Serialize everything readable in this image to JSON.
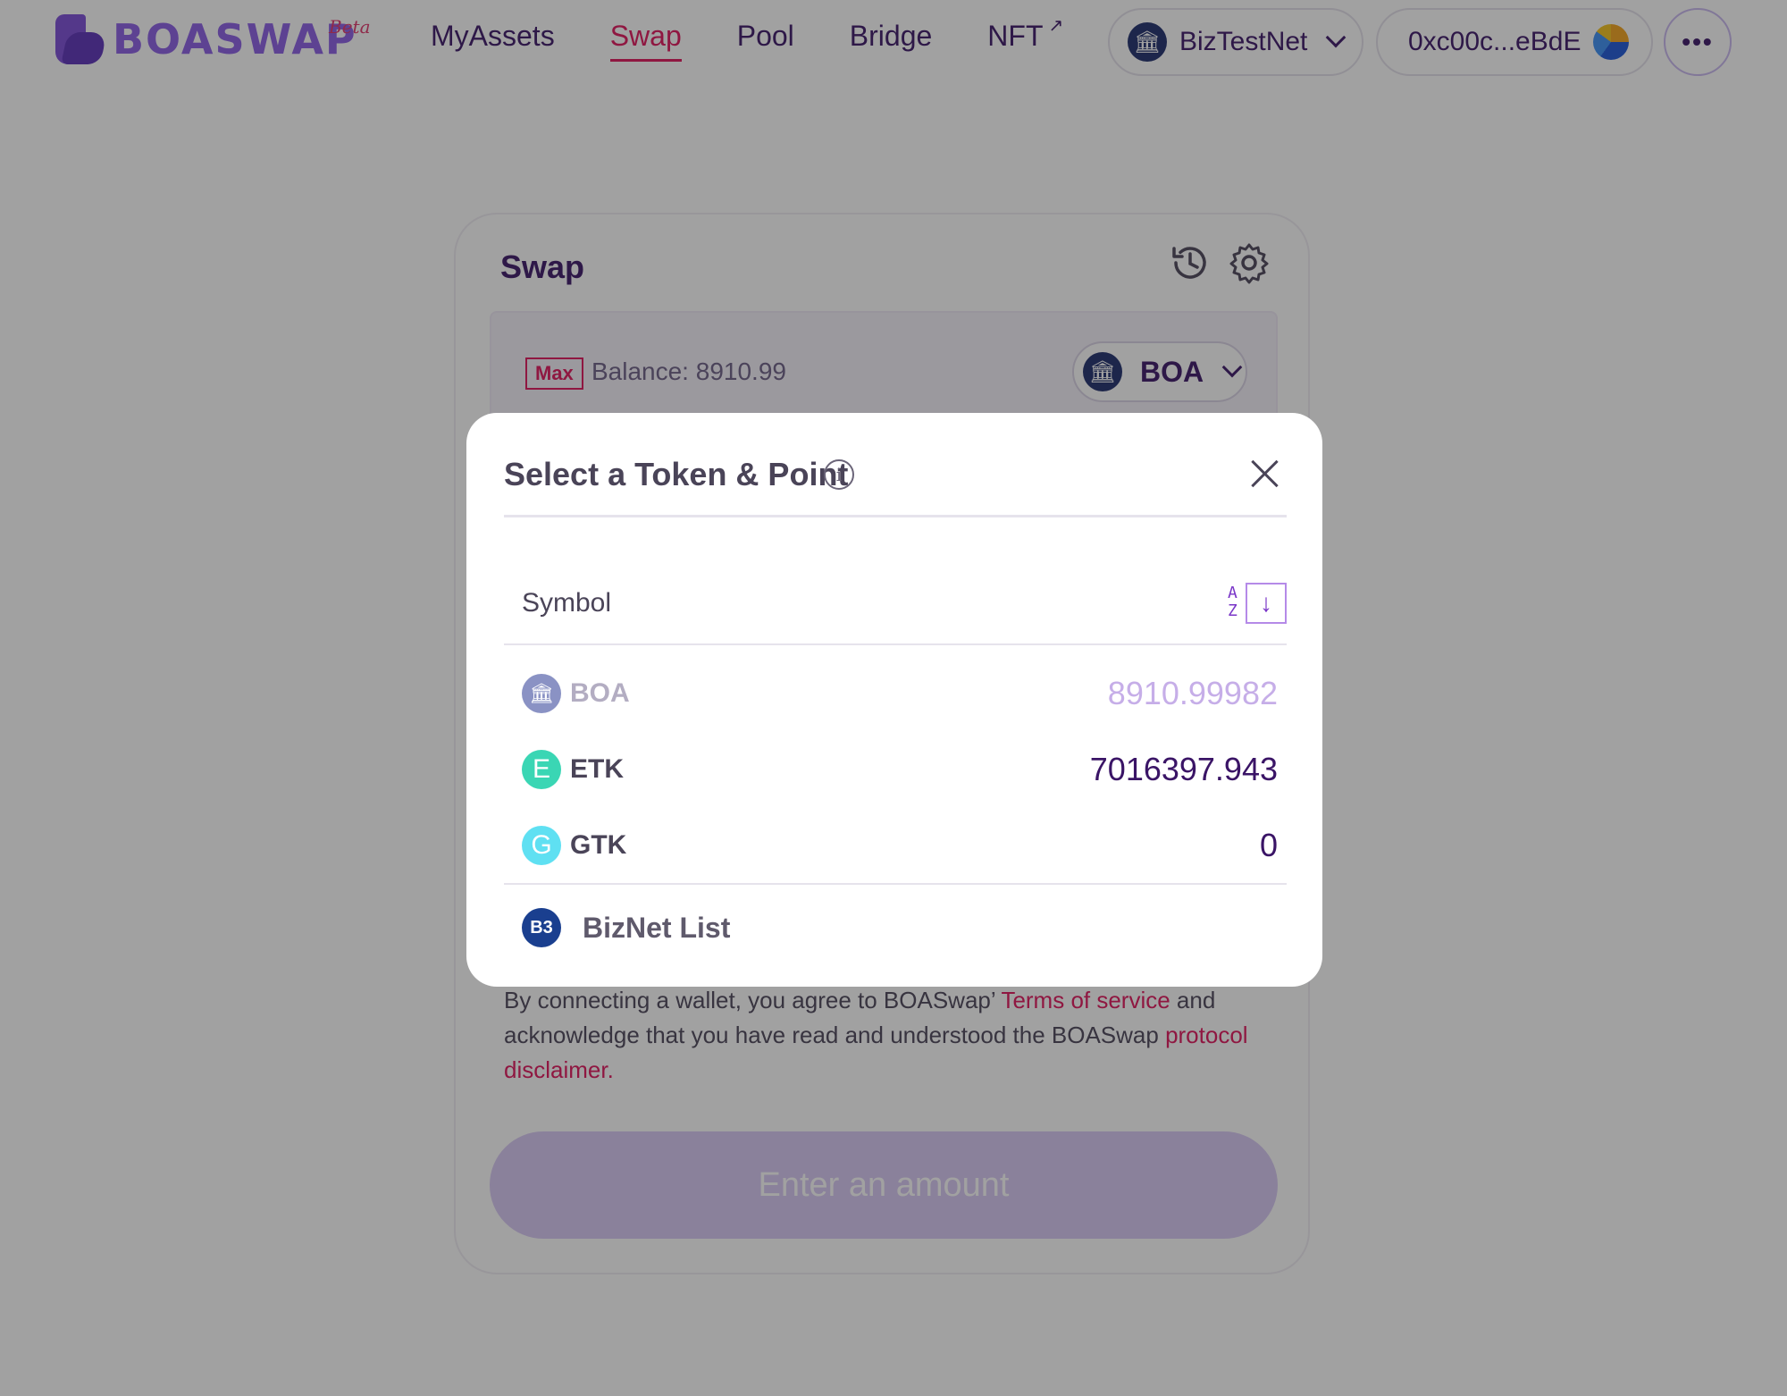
{
  "header": {
    "logo_text": "BOASWAP",
    "logo_badge": "Beta",
    "nav": [
      {
        "label": "MyAssets",
        "active": false
      },
      {
        "label": "Swap",
        "active": true
      },
      {
        "label": "Pool",
        "active": false
      },
      {
        "label": "Bridge",
        "active": false
      },
      {
        "label": "NFT",
        "active": false,
        "external_icon": "↗"
      }
    ],
    "network": {
      "icon": "bank-icon",
      "label": "BizTestNet"
    },
    "wallet": {
      "address": "0xc00c...eBdE"
    },
    "more_label": "•••"
  },
  "swap": {
    "title": "Swap",
    "max_label": "Max",
    "balance_text": "Balance: 8910.99",
    "selected_token": "BOA",
    "disclaimer": {
      "prefix": "By connecting a wallet, you agree to BOASwap’ ",
      "terms_link": "Terms of service",
      "middle": " and acknowledge that you have read and understood the BOASwap ",
      "protocol_link": "protocol disclaimer."
    },
    "action_button": "Enter an amount"
  },
  "modal": {
    "title": "Select a Token & Point",
    "info_icon": "i",
    "column_header": "Symbol",
    "sort_letters": [
      "A",
      "Z"
    ],
    "sort_arrow": "↓",
    "tokens": [
      {
        "icon_glyph": "🏛",
        "symbol": "BOA",
        "balance": "8910.99982",
        "disabled": true
      },
      {
        "icon_glyph": "E",
        "symbol": "ETK",
        "balance": "7016397.943",
        "disabled": false
      },
      {
        "icon_glyph": "G",
        "symbol": "GTK",
        "balance": "0",
        "disabled": false
      }
    ],
    "list_link": {
      "icon_glyph": "B3",
      "label": "BizNet List"
    }
  },
  "colors": {
    "accent": "#e0125a",
    "primary_text": "#3a1466",
    "logo": "#8a5ce6",
    "button_disabled": "#d8c8f4"
  }
}
